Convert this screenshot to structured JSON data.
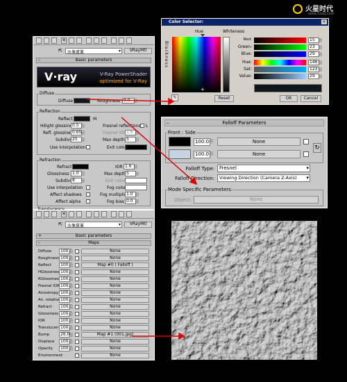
{
  "color_selector": {
    "title": "Color Selector:",
    "hue_label": "Hue",
    "whiteness_label": "Whiteness",
    "blackness_label": "Blackness",
    "channels": [
      {
        "label": "Red:",
        "value": "15"
      },
      {
        "label": "Green:",
        "value": "23"
      },
      {
        "label": "Blue:",
        "value": "29"
      },
      {
        "label": "Hue:",
        "value": "146"
      },
      {
        "label": "Sat:",
        "value": "123"
      },
      {
        "label": "Value:",
        "value": "29"
      }
    ],
    "reset": "Reset",
    "ok": "OK",
    "cancel": "Cancel"
  },
  "top_panel": {
    "material_name": "沙发皮革",
    "material_type": "VRayMtl",
    "basic_params": "Basic parameters",
    "banner_title": "V-Ray PowerShader",
    "banner_sub": "optimized for V-Ray",
    "diffuse_group": "Diffuse",
    "diffuse_label": "Diffuse",
    "roughness_label": "Roughness",
    "roughness_value": "0.0",
    "reflection_group": "Reflection",
    "reflect_label": "Reflect",
    "reflect_m": "M",
    "hilight_label": "Hilight glossiness",
    "hilight_value": "0.5",
    "refl_gloss_label": "Refl. glossiness",
    "refl_gloss_value": "0.65",
    "subdivs_label": "Subdivs",
    "subdivs_value": "25",
    "use_interp_label": "Use interpolation",
    "fresnel_label": "Fresnel reflections",
    "fresnel_l": "L",
    "fresnel_ior_label": "Fresnel IOR",
    "fresnel_ior_value": "1.6",
    "max_depth_label": "Max depth",
    "max_depth_value": "5",
    "exit_color_label": "Exit color",
    "refraction_group": "Refraction",
    "refract_label": "Refract",
    "ior_label": "IOR",
    "ior_value": "1.6",
    "gloss_label": "Glossiness",
    "gloss_value": "1.0",
    "r_max_depth_label": "Max depth",
    "r_max_depth_value": "5",
    "r_subdivs_label": "Subdivs",
    "r_subdivs_value": "8",
    "r_exit_color_label": "Exit color",
    "r_use_interp_label": "Use interpolation",
    "fog_color_label": "Fog color",
    "affect_shadows_label": "Affect shadows",
    "fog_mult_label": "Fog multiplier",
    "fog_mult_value": "1.0",
    "affect_alpha_label": "Affect alpha",
    "fog_bias_label": "Fog bias",
    "fog_bias_value": "0.0",
    "translucency_label": "Translucency"
  },
  "falloff": {
    "title": "Falloff Parameters",
    "front_side": "Front : Side",
    "row1_value": "100.0",
    "row1_map": "None",
    "row2_value": "100.0",
    "row2_map": "None",
    "falloff_type_label": "Falloff Type:",
    "falloff_type_value": "Fresnel",
    "falloff_dir_label": "Falloff Direction:",
    "falloff_dir_value": "Viewing Direction (Camera Z-Axis)",
    "mode_group": "Mode Specific Parameters:",
    "object_label": "Object:",
    "object_value": "None"
  },
  "bottom_panel": {
    "material_name": "沙发皮革",
    "material_type": "VRayMtl",
    "basic_params": "Basic parameters",
    "maps_label": "Maps",
    "maps": [
      {
        "name": "Diffuse",
        "amount": "100.0",
        "map": "None"
      },
      {
        "name": "Roughness",
        "amount": "100.0",
        "map": "None"
      },
      {
        "name": "Reflect",
        "amount": "100.0",
        "map": "Map #0 ( Falloff )"
      },
      {
        "name": "HGlossiness",
        "amount": "100.0",
        "map": "None"
      },
      {
        "name": "RGlossiness",
        "amount": "100.0",
        "map": "None"
      },
      {
        "name": "Fresnel IOR",
        "amount": "100.0",
        "map": "None"
      },
      {
        "name": "Anisotropy",
        "amount": "100.0",
        "map": "None"
      },
      {
        "name": "An. rotation",
        "amount": "100.0",
        "map": "None"
      },
      {
        "name": "Refract",
        "amount": "100.0",
        "map": "None"
      },
      {
        "name": "Glossiness",
        "amount": "100.0",
        "map": "None"
      },
      {
        "name": "IOR",
        "amount": "100.0",
        "map": "None"
      },
      {
        "name": "Translucent",
        "amount": "100.0",
        "map": "None"
      },
      {
        "name": "Bump",
        "amount": "26.0",
        "map": "Map #1 (001.jpg)"
      },
      {
        "name": "Displace",
        "amount": "100.0",
        "map": "None"
      },
      {
        "name": "Opacity",
        "amount": "100.0",
        "map": "None"
      },
      {
        "name": "Environment",
        "amount": "",
        "map": "None"
      }
    ]
  },
  "watermark": {
    "brand": "火星时代",
    "url": "www.hxsd.com"
  },
  "colors": {
    "panel": "#c8c8c8",
    "arrow": "#dd0000",
    "accent": "#ffd200"
  }
}
